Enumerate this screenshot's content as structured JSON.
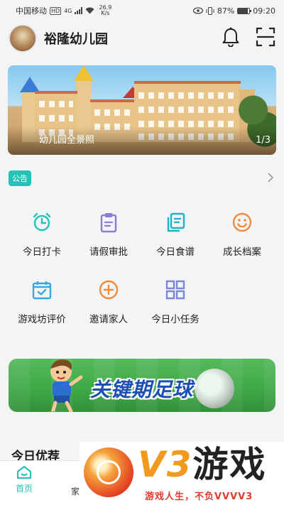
{
  "status_bar": {
    "carrier": "中国移动",
    "network_badge": "HD",
    "network_gen": "4G",
    "speed_value": "26.9",
    "speed_unit": "K/s",
    "battery": "87%",
    "battery_level": 0.87,
    "time": "09:20"
  },
  "header": {
    "school_name": "裕隆幼儿园",
    "bell_icon": "bell-icon",
    "scan_icon": "scan-icon"
  },
  "banner": {
    "caption": "幼儿园全景照",
    "page": "1/3"
  },
  "notice": {
    "tag": "公告"
  },
  "functions": [
    {
      "label": "今日打卡",
      "icon": "alarm-clock-icon",
      "color": "#23c3b7"
    },
    {
      "label": "请假审批",
      "icon": "clipboard-icon",
      "color": "#8b7bd8"
    },
    {
      "label": "今日食谱",
      "icon": "copy-document-icon",
      "color": "#1fb3c8"
    },
    {
      "label": "成长档案",
      "icon": "smile-icon",
      "color": "#f28a3c"
    },
    {
      "label": "游戏坊评价",
      "icon": "calendar-check-icon",
      "color": "#3aa8e0"
    },
    {
      "label": "邀请家人",
      "icon": "plus-circle-icon",
      "color": "#f28a3c"
    },
    {
      "label": "今日小任务",
      "icon": "grid-apps-icon",
      "color": "#7b86d8"
    }
  ],
  "promo": {
    "text": "关键期足球"
  },
  "recommend": {
    "title": "今日优荐"
  },
  "bottom_nav": {
    "home": "首页",
    "family": "家"
  },
  "watermark": {
    "brand_v3": "V3",
    "brand_game": "游戏",
    "slogan": "游戏人生，不负VVVV3"
  },
  "colors": {
    "accent": "#23c3b7",
    "background": "#f3f4f6"
  }
}
